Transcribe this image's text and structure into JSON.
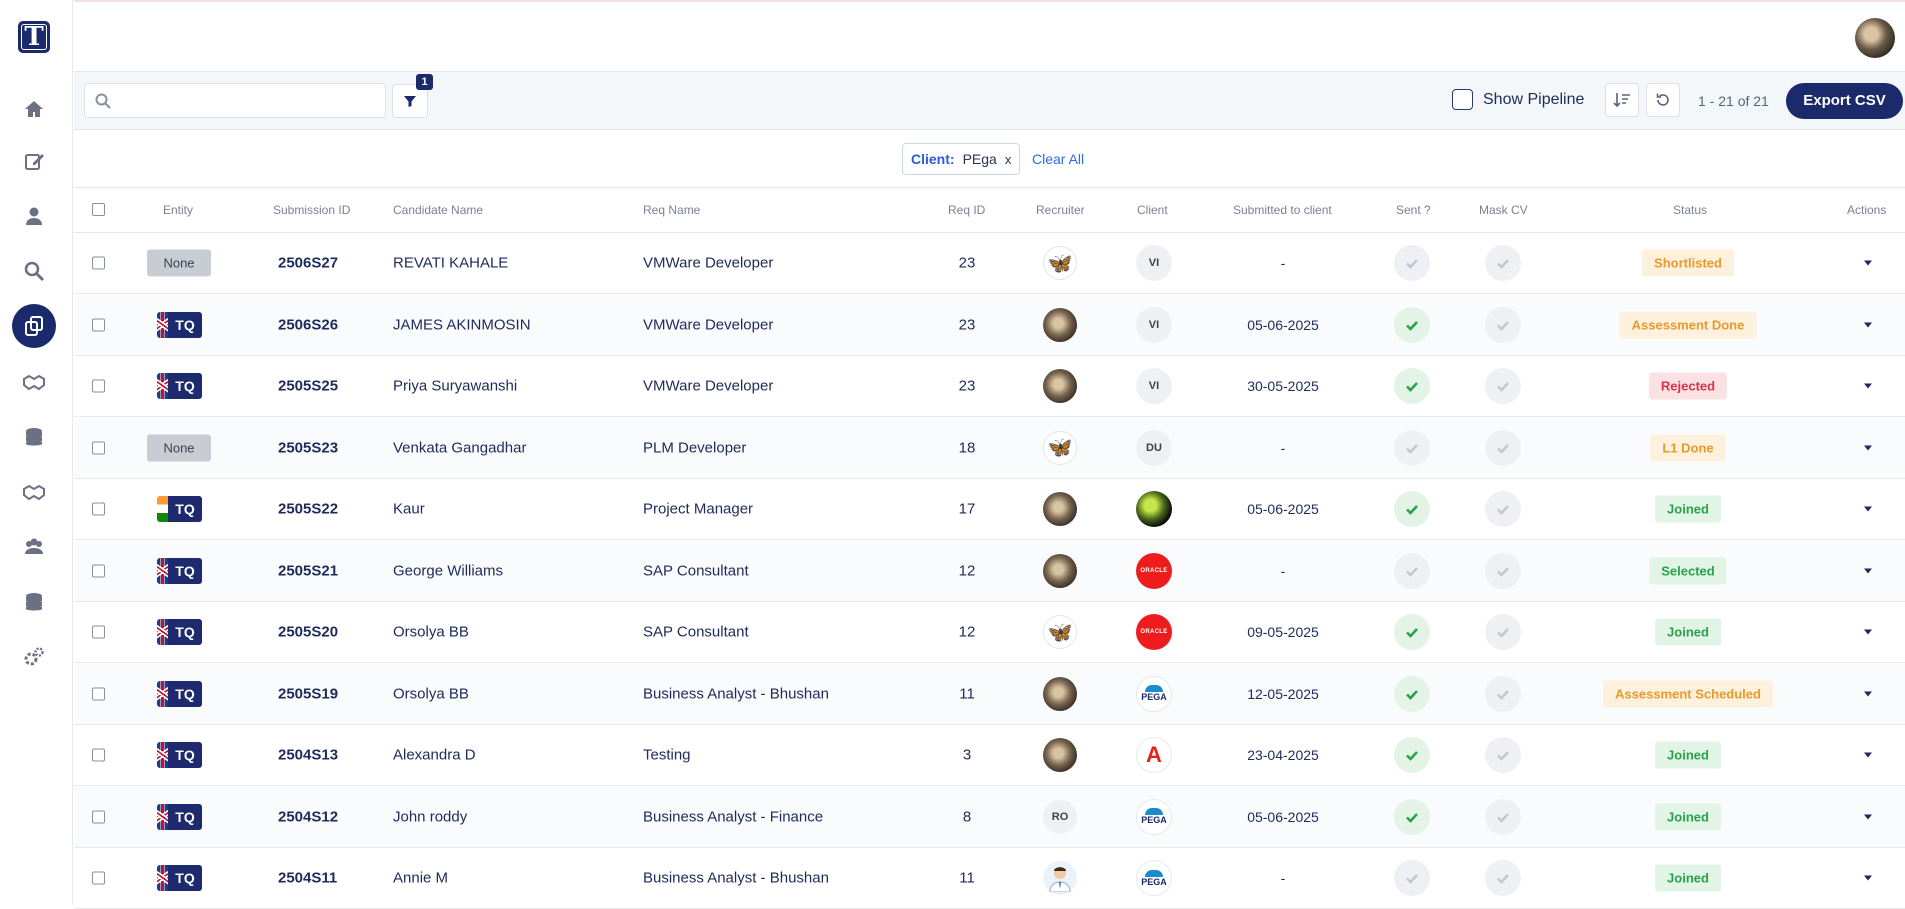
{
  "app": {
    "logo_letter": "T",
    "nav": [
      "home-icon",
      "edit-icon",
      "user-icon",
      "search-icon",
      "submissions-icon",
      "handshake-icon",
      "database-icon",
      "handshake-alt-icon",
      "users-icon",
      "database-alt-icon",
      "settings-icon"
    ],
    "active_nav": "submissions-icon"
  },
  "toolbar": {
    "search_value": "",
    "filter_count": "1",
    "show_pipeline_label": "Show Pipeline",
    "pagination": "1 - 21 of 21",
    "export_label": "Export CSV"
  },
  "filters": {
    "chip_key": "Client:",
    "chip_value": "PEga",
    "chip_remove": "x",
    "clear_all": "Clear All"
  },
  "table": {
    "headers": {
      "entity": "Entity",
      "submission_id": "Submission ID",
      "candidate_name": "Candidate Name",
      "req_name": "Req Name",
      "req_id": "Req ID",
      "recruiter": "Recruiter",
      "client": "Client",
      "submitted": "Submitted to client",
      "sent": "Sent ?",
      "mask_cv": "Mask CV",
      "status": "Status",
      "actions": "Actions"
    },
    "rows": [
      {
        "entity": "None",
        "flag": "",
        "submission_id": "2506S27",
        "candidate": "REVATI KAHALE",
        "req_name": "VMWare Developer",
        "req_id": "23",
        "recruiter": "butterfly",
        "client": "VI",
        "client_type": "init",
        "submitted": "-",
        "sent": false,
        "mask": false,
        "status": "Shortlisted",
        "status_color": "orange"
      },
      {
        "entity": "TQ",
        "flag": "uk",
        "submission_id": "2506S26",
        "candidate": "JAMES AKINMOSIN",
        "req_name": "VMWare Developer",
        "req_id": "23",
        "recruiter": "photo",
        "client": "VI",
        "client_type": "init",
        "submitted": "05-06-2025",
        "sent": true,
        "mask": false,
        "status": "Assessment Done",
        "status_color": "orange"
      },
      {
        "entity": "TQ",
        "flag": "uk",
        "submission_id": "2505S25",
        "candidate": "Priya Suryawanshi",
        "req_name": "VMWare Developer",
        "req_id": "23",
        "recruiter": "photo",
        "client": "VI",
        "client_type": "init",
        "submitted": "30-05-2025",
        "sent": true,
        "mask": false,
        "status": "Rejected",
        "status_color": "red"
      },
      {
        "entity": "None",
        "flag": "",
        "submission_id": "2505S23",
        "candidate": "Venkata Gangadhar",
        "req_name": "PLM Developer",
        "req_id": "18",
        "recruiter": "butterfly",
        "client": "DU",
        "client_type": "init",
        "submitted": "-",
        "sent": false,
        "mask": false,
        "status": "L1 Done",
        "status_color": "orange"
      },
      {
        "entity": "TQ",
        "flag": "in",
        "submission_id": "2505S22",
        "candidate": "Kaur",
        "req_name": "Project Manager",
        "req_id": "17",
        "recruiter": "photo",
        "client": "",
        "client_type": "ball",
        "submitted": "05-06-2025",
        "sent": true,
        "mask": false,
        "status": "Joined",
        "status_color": "green"
      },
      {
        "entity": "TQ",
        "flag": "uk",
        "submission_id": "2505S21",
        "candidate": "George Williams",
        "req_name": "SAP Consultant",
        "req_id": "12",
        "recruiter": "photo",
        "client": "ORACLE",
        "client_type": "oracle",
        "submitted": "-",
        "sent": false,
        "mask": false,
        "status": "Selected",
        "status_color": "green"
      },
      {
        "entity": "TQ",
        "flag": "uk",
        "submission_id": "2505S20",
        "candidate": "Orsolya BB",
        "req_name": "SAP Consultant",
        "req_id": "12",
        "recruiter": "butterfly",
        "client": "ORACLE",
        "client_type": "oracle",
        "submitted": "09-05-2025",
        "sent": true,
        "mask": false,
        "status": "Joined",
        "status_color": "green"
      },
      {
        "entity": "TQ",
        "flag": "uk",
        "submission_id": "2505S19",
        "candidate": "Orsolya BB",
        "req_name": "Business Analyst - Bhushan",
        "req_id": "11",
        "recruiter": "photo",
        "client": "PEGA",
        "client_type": "pega",
        "submitted": "12-05-2025",
        "sent": true,
        "mask": false,
        "status": "Assessment Scheduled",
        "status_color": "orange"
      },
      {
        "entity": "TQ",
        "flag": "uk",
        "submission_id": "2504S13",
        "candidate": "Alexandra D",
        "req_name": "Testing",
        "req_id": "3",
        "recruiter": "photo",
        "client": "A",
        "client_type": "adobe",
        "submitted": "23-04-2025",
        "sent": true,
        "mask": false,
        "status": "Joined",
        "status_color": "green"
      },
      {
        "entity": "TQ",
        "flag": "uk",
        "submission_id": "2504S12",
        "candidate": "John roddy",
        "req_name": "Business Analyst - Finance",
        "req_id": "8",
        "recruiter": "RO",
        "client": "PEGA",
        "client_type": "pega",
        "submitted": "05-06-2025",
        "sent": true,
        "mask": false,
        "status": "Joined",
        "status_color": "green"
      },
      {
        "entity": "TQ",
        "flag": "uk",
        "submission_id": "2504S11",
        "candidate": "Annie M",
        "req_name": "Business Analyst - Bhushan",
        "req_id": "11",
        "recruiter": "person",
        "client": "PEGA",
        "client_type": "pega",
        "submitted": "-",
        "sent": false,
        "mask": false,
        "status": "Joined",
        "status_color": "green"
      }
    ]
  }
}
